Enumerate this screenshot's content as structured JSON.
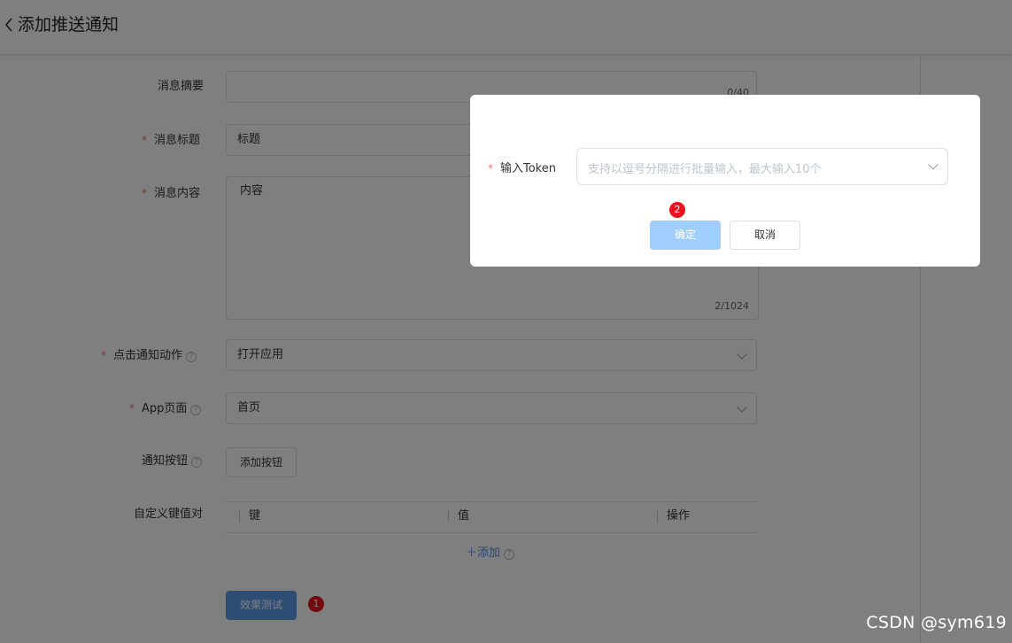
{
  "header": {
    "title": "添加推送通知"
  },
  "form": {
    "summary": {
      "label": "消息摘要",
      "value": "",
      "counter": "0/40"
    },
    "title": {
      "label": "消息标题",
      "value": "标题"
    },
    "content": {
      "label": "消息内容",
      "value": "内容",
      "counter": "2/1024"
    },
    "click_action": {
      "label": "点击通知动作",
      "value": "打开应用"
    },
    "app_page": {
      "label": "App页面",
      "value": "首页"
    },
    "notify_button": {
      "label": "通知按钮",
      "button": "添加按钮"
    },
    "kv": {
      "label": "自定义键值对",
      "columns": [
        "键",
        "值",
        "操作"
      ],
      "add": "添加"
    },
    "test_button": "效果测试",
    "required_mark": "*",
    "help_mark": "?"
  },
  "markers": {
    "one": "1",
    "two": "2"
  },
  "dialog": {
    "token_label": "输入Token",
    "token_placeholder": "支持以逗号分隔进行批量输入，最大输入10个",
    "confirm": "确定",
    "cancel": "取消"
  },
  "watermark": "CSDN @sym619",
  "colors": {
    "primary": "#5b9be8",
    "primary_disabled": "#a0cfff",
    "danger": "#f56c6c",
    "marker": "#e8141b",
    "link": "#4a90e2"
  }
}
